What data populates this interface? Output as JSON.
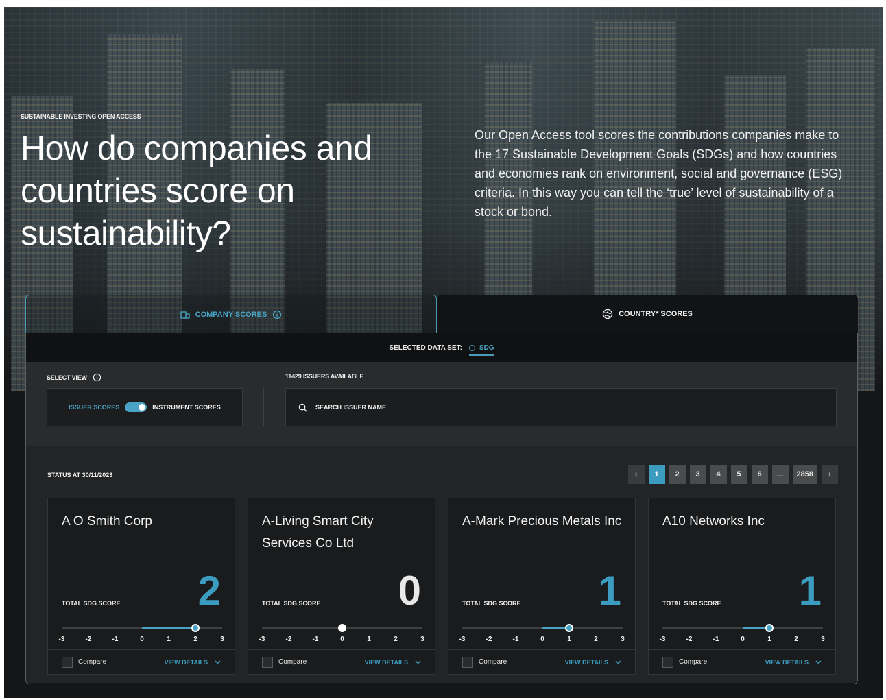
{
  "hero": {
    "kicker": "SUSTAINABLE INVESTING OPEN ACCESS",
    "title": "How do companies and countries score on sustainability?",
    "description": "Our Open Access tool scores the contributions companies make to the 17 Sustainable Development Goals (SDGs) and how countries and economies rank on environment, social and governance (ESG) criteria. In this way you can tell the ‘true’ level of sustainability of a stock or bond."
  },
  "tabs": {
    "company": "COMPANY SCORES",
    "country": "COUNTRY* SCORES"
  },
  "dataset": {
    "label": "SELECTED DATA SET:",
    "value": "SDG"
  },
  "controls": {
    "select_view_label": "SELECT VIEW",
    "toggle_left": "ISSUER SCORES",
    "toggle_right": "INSTRUMENT SCORES",
    "issuers_available": "11429 ISSUERS AVAILABLE",
    "search_placeholder": "SEARCH ISSUER NAME"
  },
  "status": "STATUS AT 30/11/2023",
  "pagination": {
    "prev": "‹",
    "pages": [
      "1",
      "2",
      "3",
      "4",
      "5",
      "6",
      "...",
      "2858"
    ],
    "active": "1",
    "next": "›"
  },
  "scale_ticks": [
    "-3",
    "-2",
    "-1",
    "0",
    "1",
    "2",
    "3"
  ],
  "cards": [
    {
      "name": "A O Smith Corp",
      "score_label": "TOTAL SDG SCORE",
      "score": "2",
      "score_value": 2,
      "score_color": "#3b9cc0",
      "compare": "Compare",
      "details": "VIEW DETAILS"
    },
    {
      "name": "A-Living Smart City Services Co Ltd",
      "score_label": "TOTAL SDG SCORE",
      "score": "0",
      "score_value": 0,
      "score_color": "#e8e8e8",
      "compare": "Compare",
      "details": "VIEW DETAILS"
    },
    {
      "name": "A-Mark Precious Metals Inc",
      "score_label": "TOTAL SDG SCORE",
      "score": "1",
      "score_value": 1,
      "score_color": "#3b9cc0",
      "compare": "Compare",
      "details": "VIEW DETAILS"
    },
    {
      "name": "A10 Networks Inc",
      "score_label": "TOTAL SDG SCORE",
      "score": "1",
      "score_value": 1,
      "score_color": "#3b9cc0",
      "compare": "Compare",
      "details": "VIEW DETAILS"
    }
  ],
  "colors": {
    "accent": "#3b9cc0",
    "background": "#151617",
    "card": "#1a1b1c"
  }
}
